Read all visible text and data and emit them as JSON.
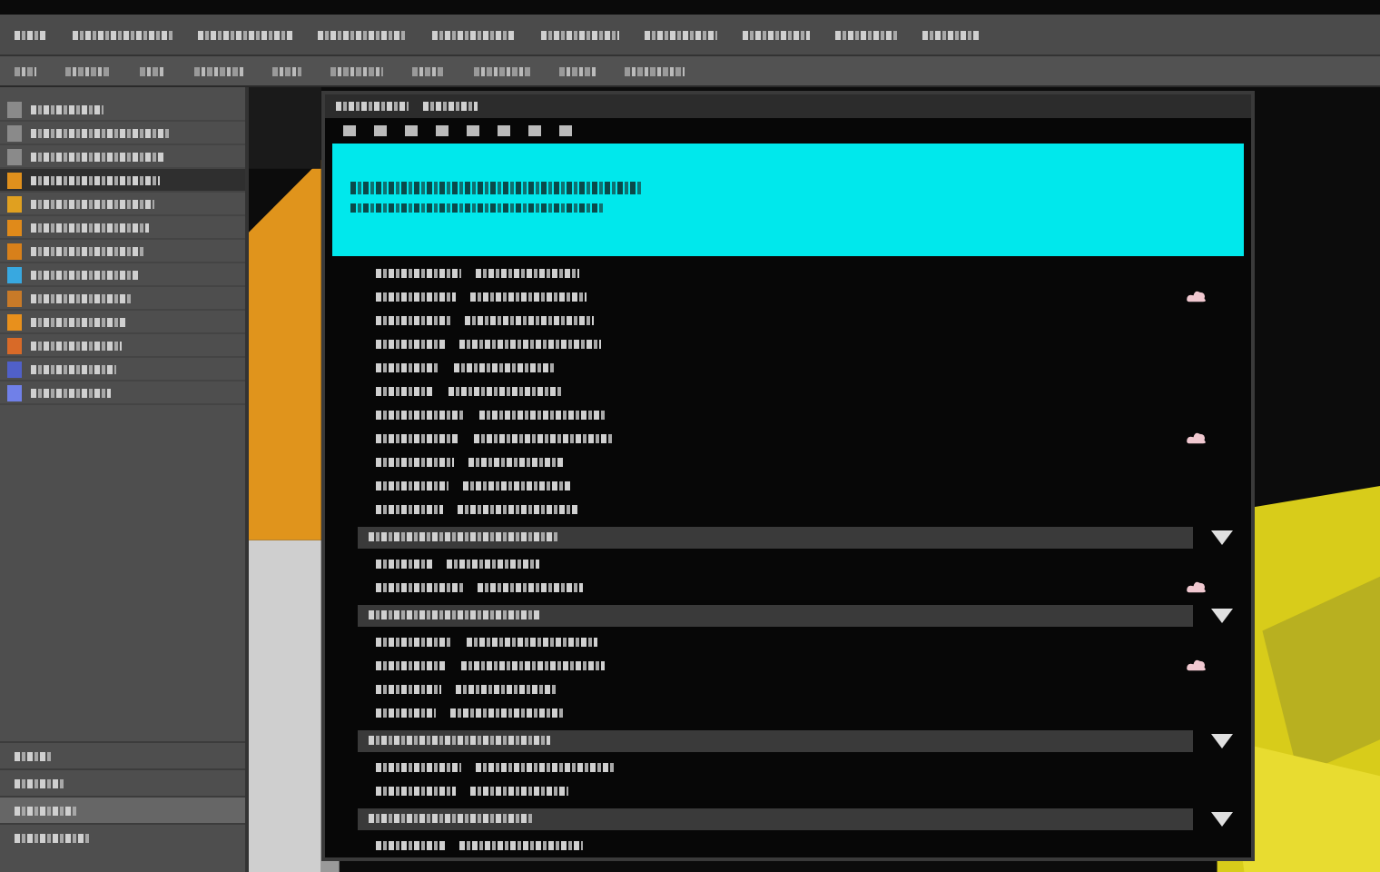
{
  "menu_bar": {
    "items": [
      {
        "kind": "menu"
      },
      {
        "kind": "menu"
      },
      {
        "kind": "menu"
      },
      {
        "kind": "menu"
      },
      {
        "kind": "menu"
      },
      {
        "kind": "menu"
      },
      {
        "kind": "menu"
      },
      {
        "kind": "menu"
      },
      {
        "kind": "menu"
      },
      {
        "kind": "menu"
      }
    ]
  },
  "options_bar": {
    "items": [
      {
        "kind": "field"
      },
      {
        "kind": "field"
      },
      {
        "kind": "field"
      },
      {
        "kind": "field"
      },
      {
        "kind": "field"
      },
      {
        "kind": "field"
      },
      {
        "kind": "field"
      },
      {
        "kind": "field"
      },
      {
        "kind": "field"
      },
      {
        "kind": "field"
      }
    ]
  },
  "sidebar": {
    "items": [
      {
        "color": "#8a8a8a",
        "selected": false
      },
      {
        "color": "#8a8a8a",
        "selected": false
      },
      {
        "color": "#8a8a8a",
        "selected": false
      },
      {
        "color": "#e0901c",
        "selected": true
      },
      {
        "color": "#e0a020",
        "selected": false
      },
      {
        "color": "#e08a1a",
        "selected": false
      },
      {
        "color": "#d8801a",
        "selected": false
      },
      {
        "color": "#38a8e0",
        "selected": false
      },
      {
        "color": "#c87a28",
        "selected": false
      },
      {
        "color": "#e8901c",
        "selected": false
      },
      {
        "color": "#d86a28",
        "selected": false
      },
      {
        "color": "#5060c8",
        "selected": false
      },
      {
        "color": "#7080e8",
        "selected": false
      }
    ],
    "footer_items": [
      {
        "selected": false
      },
      {
        "selected": false
      },
      {
        "selected": true
      },
      {
        "selected": false
      }
    ]
  },
  "window": {
    "rows": [
      {
        "kind": "banner"
      },
      {
        "kind": "entry",
        "marked": false
      },
      {
        "kind": "entry",
        "marked": true
      },
      {
        "kind": "entry",
        "marked": false
      },
      {
        "kind": "entry",
        "marked": false
      },
      {
        "kind": "entry",
        "marked": false
      },
      {
        "kind": "entry",
        "marked": false
      },
      {
        "kind": "entry",
        "marked": false
      },
      {
        "kind": "entry",
        "marked": true
      },
      {
        "kind": "entry",
        "marked": false
      },
      {
        "kind": "entry",
        "marked": false
      },
      {
        "kind": "entry",
        "marked": false
      },
      {
        "kind": "group",
        "marked": true
      },
      {
        "kind": "entry",
        "marked": false
      },
      {
        "kind": "entry",
        "marked": true
      },
      {
        "kind": "group",
        "marked": true
      },
      {
        "kind": "entry",
        "marked": false
      },
      {
        "kind": "entry",
        "marked": true
      },
      {
        "kind": "entry",
        "marked": false
      },
      {
        "kind": "entry",
        "marked": false
      },
      {
        "kind": "group",
        "marked": true
      },
      {
        "kind": "entry",
        "marked": false
      },
      {
        "kind": "entry",
        "marked": false
      },
      {
        "kind": "group",
        "marked": true
      },
      {
        "kind": "entry",
        "marked": false
      }
    ]
  }
}
